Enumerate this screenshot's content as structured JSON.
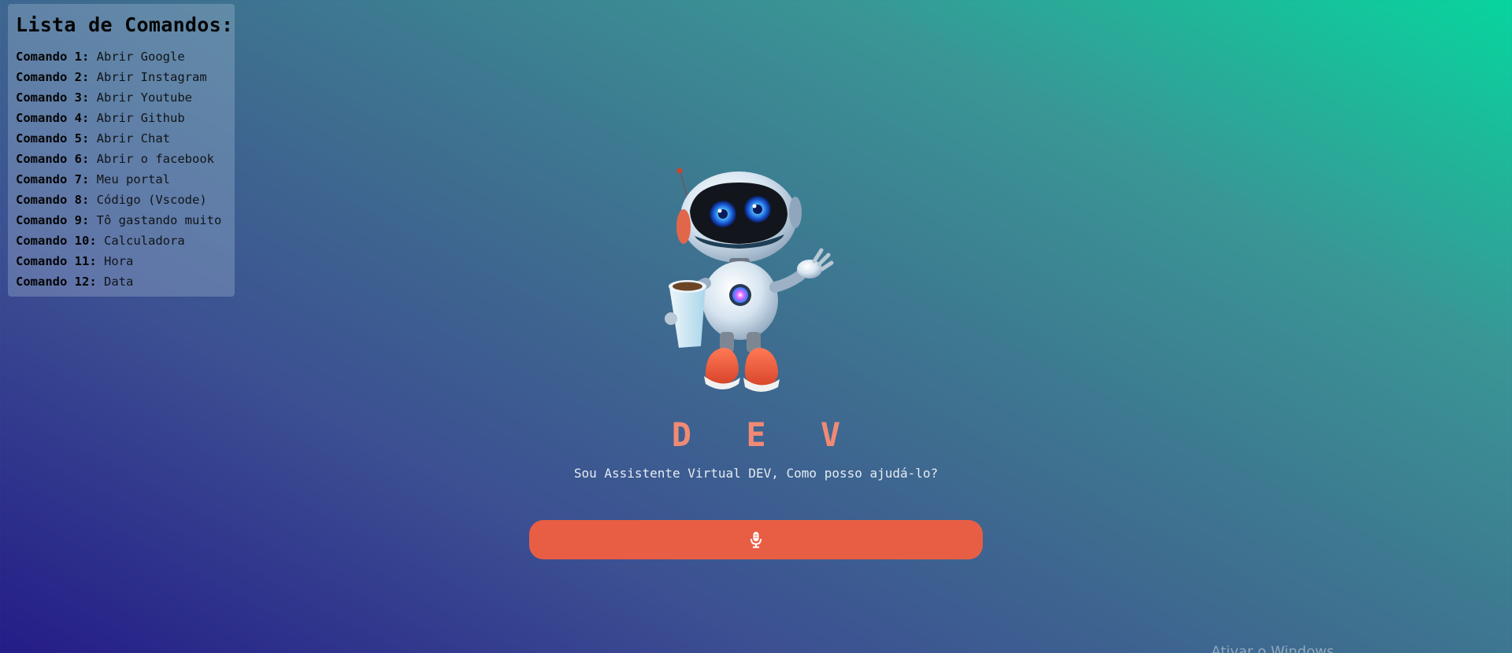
{
  "commands_panel": {
    "title": "Lista de Comandos:",
    "items": [
      {
        "key": "Comando 1:",
        "value": "Abrir Google"
      },
      {
        "key": "Comando 2:",
        "value": "Abrir Instagram"
      },
      {
        "key": "Comando 3:",
        "value": "Abrir Youtube"
      },
      {
        "key": "Comando 4:",
        "value": "Abrir Github"
      },
      {
        "key": "Comando 5:",
        "value": "Abrir Chat"
      },
      {
        "key": "Comando 6:",
        "value": "Abrir o facebook"
      },
      {
        "key": "Comando 7:",
        "value": "Meu portal"
      },
      {
        "key": "Comando 8:",
        "value": "Código (Vscode)"
      },
      {
        "key": "Comando 9:",
        "value": "Tô gastando muito"
      },
      {
        "key": "Comando 10:",
        "value": "Calculadora"
      },
      {
        "key": "Comando 11:",
        "value": "Hora"
      },
      {
        "key": "Comando 12:",
        "value": "Data"
      }
    ]
  },
  "assistant": {
    "name": "D E V",
    "subtitle": "Sou Assistente Virtual DEV, Como posso ajudá-lo?",
    "mascot_icon": "robot-mascot-icon"
  },
  "mic_button": {
    "icon": "microphone-icon",
    "color": "#e85e44"
  },
  "watermark": {
    "text": "Ativar o Windows"
  },
  "colors": {
    "title_accent": "#f08a74",
    "gradient_start": "#241c87",
    "gradient_end": "#07d59e"
  }
}
